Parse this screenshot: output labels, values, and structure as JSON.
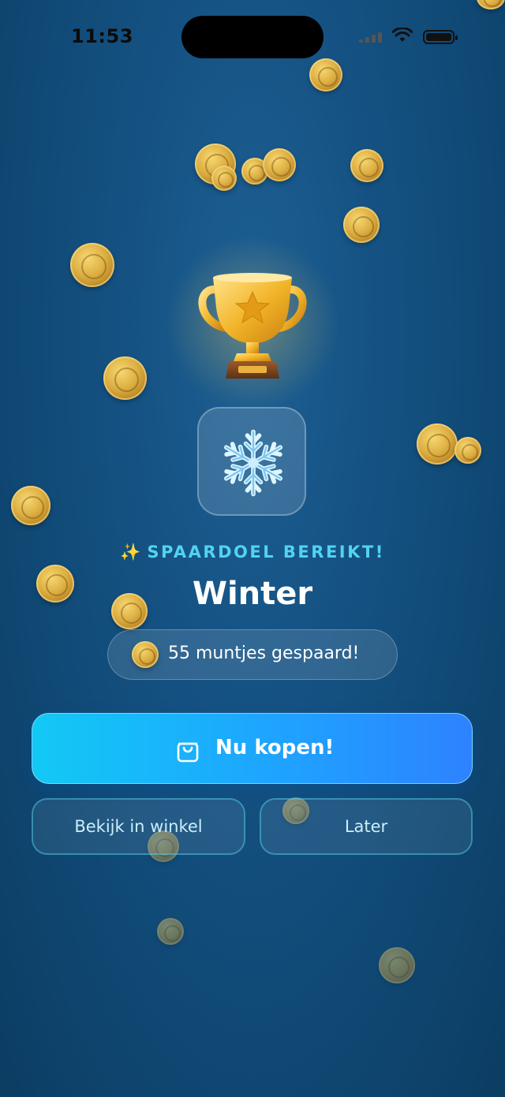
{
  "status_bar": {
    "time": "11:53"
  },
  "goal": {
    "badge_text": "SPAARDOEL BEREIKT!",
    "sparkle_icon": "✨",
    "title": "Winter",
    "saved_text": "55 muntjes gespaard!"
  },
  "actions": {
    "buy_label": "Nu kopen!",
    "shop_label": "Bekijk in winkel",
    "later_label": "Later"
  },
  "colors": {
    "accent": "#52d3f0",
    "buy_start": "#12c9f5",
    "buy_end": "#2e82ff"
  }
}
